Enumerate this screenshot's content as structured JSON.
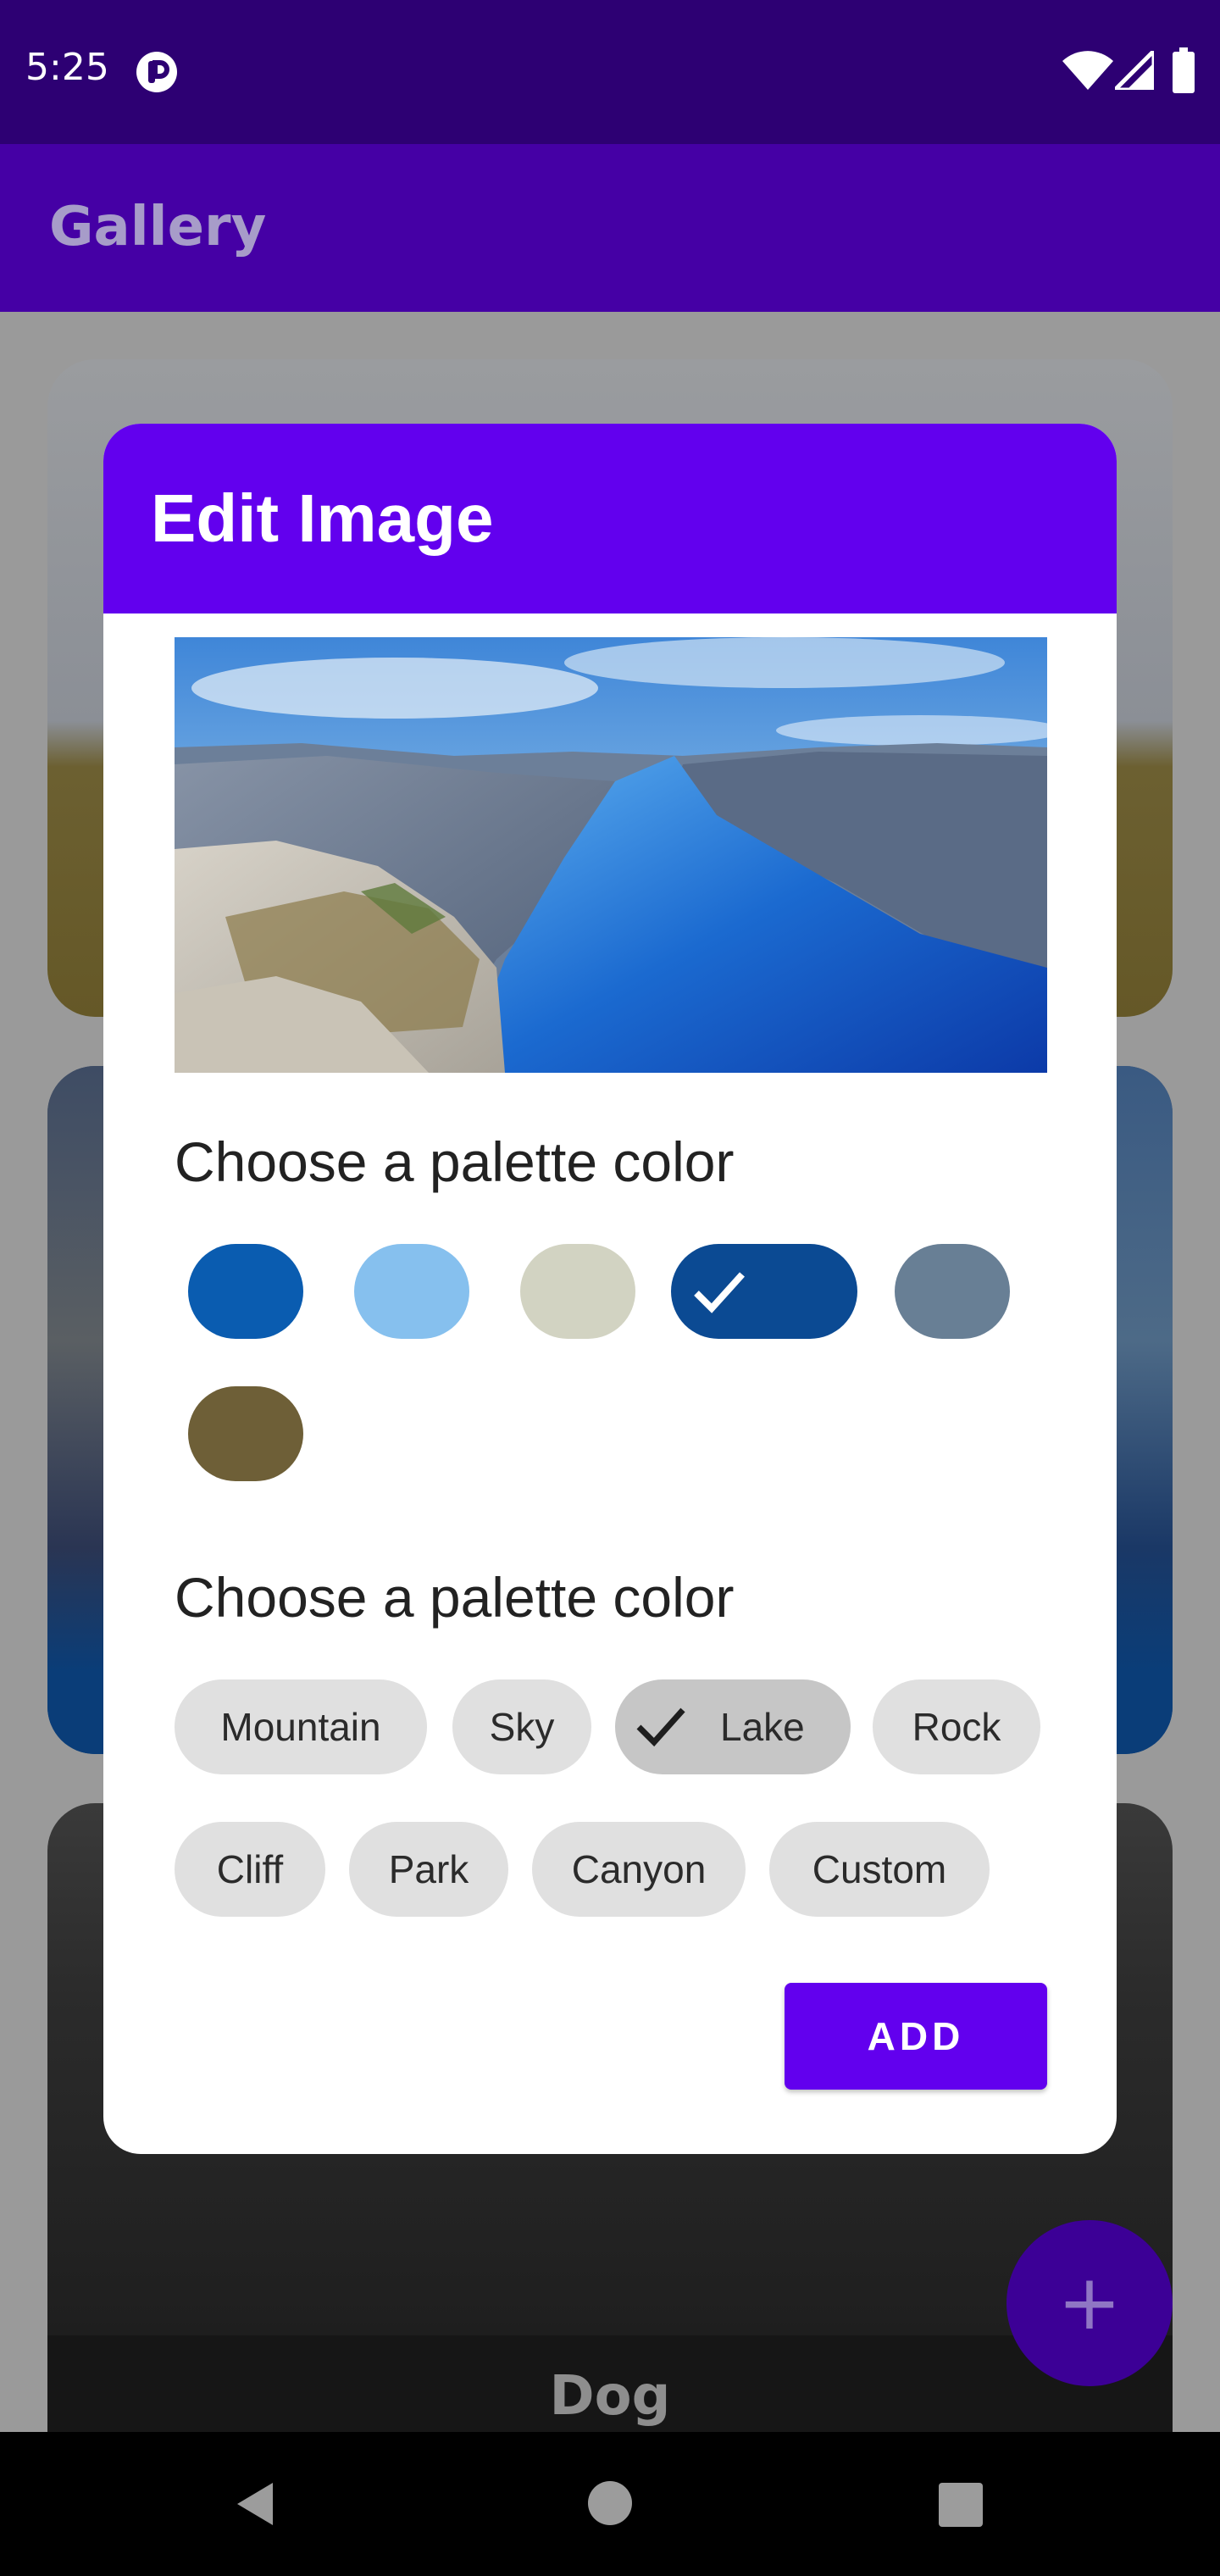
{
  "status_bar": {
    "time": "5:25",
    "icons": [
      "app-notification-icon",
      "wifi-icon",
      "cell-signal-icon",
      "battery-icon"
    ]
  },
  "app_bar": {
    "title": "Gallery"
  },
  "background_cards": [
    {
      "caption": ""
    },
    {
      "caption": ""
    },
    {
      "caption": "Dog"
    }
  ],
  "fab": {
    "label": "+",
    "icon": "add-icon"
  },
  "dialog": {
    "title": "Edit Image",
    "header_color": "#6200ee",
    "palette_section_title": "Choose a palette color",
    "swatches": [
      {
        "color": "#0a5cb0",
        "selected": false
      },
      {
        "color": "#86c0ee",
        "selected": false
      },
      {
        "color": "#d2d3c2",
        "selected": false
      },
      {
        "color": "#0b4a93",
        "selected": true
      },
      {
        "color": "#687f95",
        "selected": false
      },
      {
        "color": "#6e5f37",
        "selected": false
      }
    ],
    "tag_section_title": "Choose a palette color",
    "tags": [
      {
        "label": "Mountain",
        "selected": false
      },
      {
        "label": "Sky",
        "selected": false
      },
      {
        "label": "Lake",
        "selected": true
      },
      {
        "label": "Rock",
        "selected": false
      },
      {
        "label": "Cliff",
        "selected": false
      },
      {
        "label": "Park",
        "selected": false
      },
      {
        "label": "Canyon",
        "selected": false
      },
      {
        "label": "Custom",
        "selected": false
      }
    ],
    "add_button_label": "ADD"
  },
  "nav_bar": {
    "icons": [
      "back-icon",
      "home-icon",
      "recents-icon"
    ]
  }
}
